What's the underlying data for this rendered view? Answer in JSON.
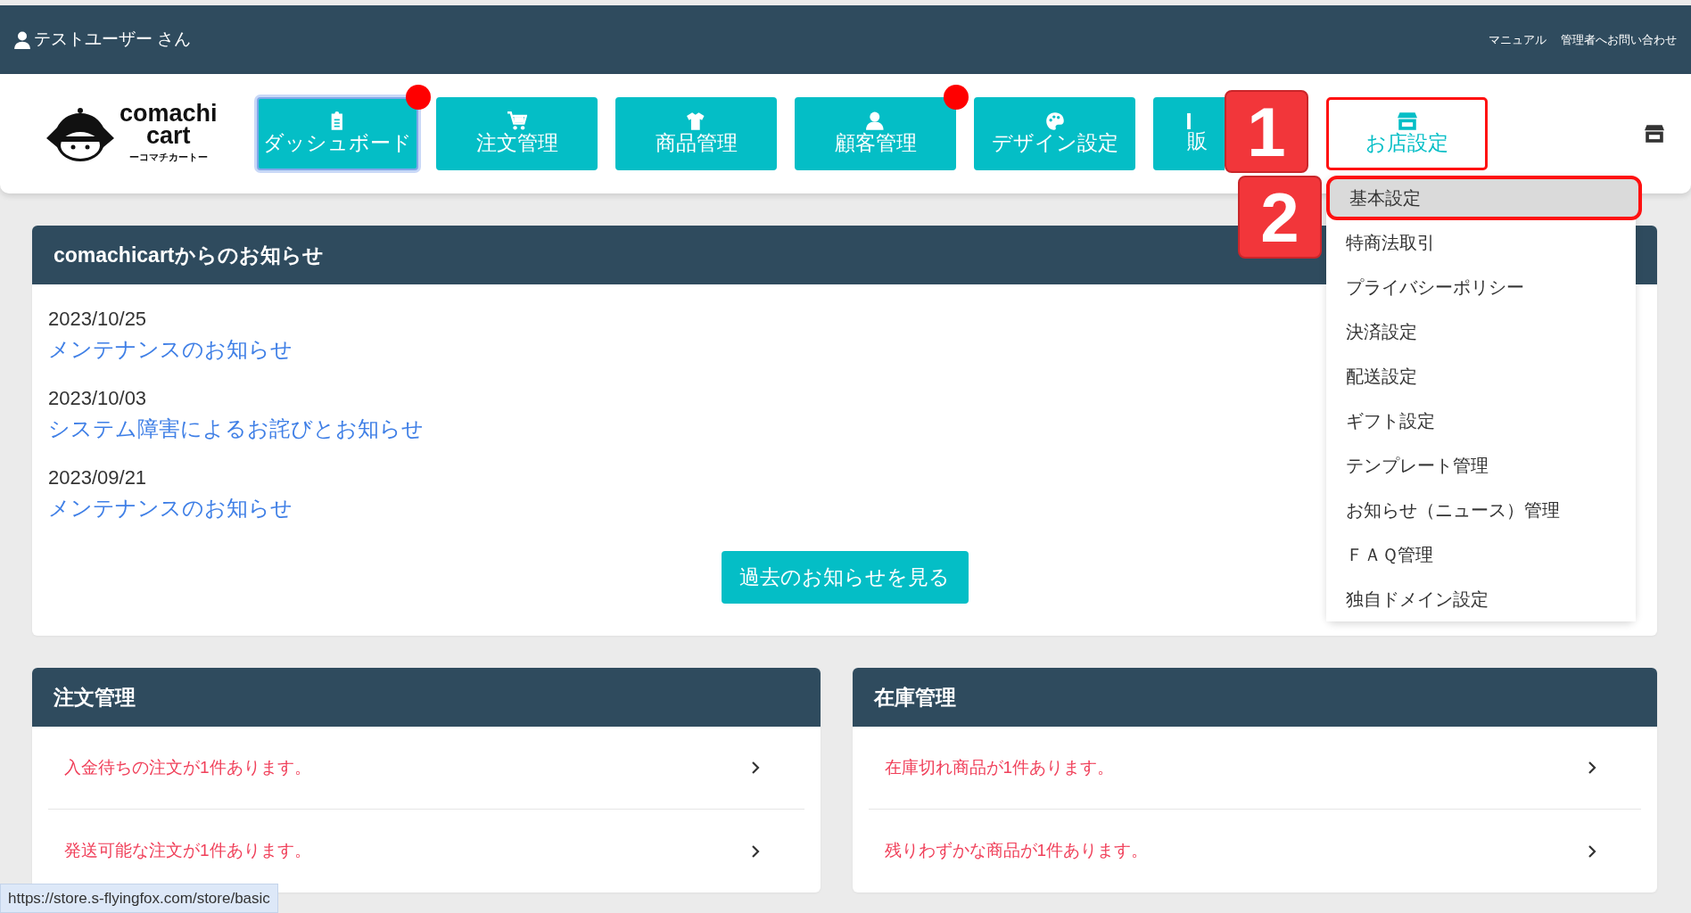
{
  "user_bar": {
    "user": "テストユーザー さん",
    "links": [
      "マニュアル",
      "管理者へお問い合わせ"
    ]
  },
  "logo": {
    "lines": [
      "comachi",
      "cart"
    ],
    "subtitle": "ーコマチカートー"
  },
  "nav": [
    {
      "label": "ダッシュボード",
      "focused": true,
      "notified": true,
      "expanded": false,
      "highlighted": false
    },
    {
      "label": "注文管理",
      "focused": false,
      "notified": false,
      "expanded": false,
      "highlighted": false
    },
    {
      "label": "商品管理",
      "focused": false,
      "notified": false,
      "expanded": false,
      "highlighted": false
    },
    {
      "label": "顧客管理",
      "focused": false,
      "notified": true,
      "expanded": false,
      "highlighted": false
    },
    {
      "label": "デザイン設定",
      "focused": false,
      "notified": false,
      "expanded": false,
      "highlighted": false
    },
    {
      "label": "販",
      "focused": false,
      "notified": false,
      "expanded": false,
      "highlighted": false
    },
    {
      "label": "お店設定",
      "focused": false,
      "notified": false,
      "expanded": true,
      "highlighted": true
    }
  ],
  "callouts": [
    {
      "label": "1"
    },
    {
      "label": "2"
    }
  ],
  "store_menu": {
    "items": [
      {
        "label": "基本設定",
        "selected": true,
        "highlighted": true
      },
      {
        "label": "特商法取引",
        "selected": false,
        "highlighted": false
      },
      {
        "label": "プライバシーポリシー",
        "selected": false,
        "highlighted": false
      },
      {
        "label": "決済設定",
        "selected": false,
        "highlighted": false
      },
      {
        "label": "配送設定",
        "selected": false,
        "highlighted": false
      },
      {
        "label": "ギフト設定",
        "selected": false,
        "highlighted": false
      },
      {
        "label": "テンプレート管理",
        "selected": false,
        "highlighted": false
      },
      {
        "label": "お知らせ（ニュース）管理",
        "selected": false,
        "highlighted": false
      },
      {
        "label": "ＦＡＱ管理",
        "selected": false,
        "highlighted": false
      },
      {
        "label": "独自ドメイン設定",
        "selected": false,
        "highlighted": false
      }
    ]
  },
  "notice": {
    "title": "comachicartからのお知らせ",
    "entries": [
      {
        "date": "2023/10/25",
        "title": "メンテナンスのお知らせ"
      },
      {
        "date": "2023/10/03",
        "title": "システム障害によるお詫びとお知らせ"
      },
      {
        "date": "2023/09/21",
        "title": "メンテナンスのお知らせ"
      }
    ],
    "button": "過去のお知らせを見る"
  },
  "panels": [
    {
      "title": "注文管理",
      "rows": [
        "入金待ちの注文が1件あります。",
        "発送可能な注文が1件あります。"
      ]
    },
    {
      "title": "在庫管理",
      "rows": [
        "在庫切れ商品が1件あります。",
        "残りわずかな商品が1件あります。"
      ]
    }
  ],
  "status_bar": {
    "url": "https://store.s-flyingfox.com/store/basic"
  }
}
